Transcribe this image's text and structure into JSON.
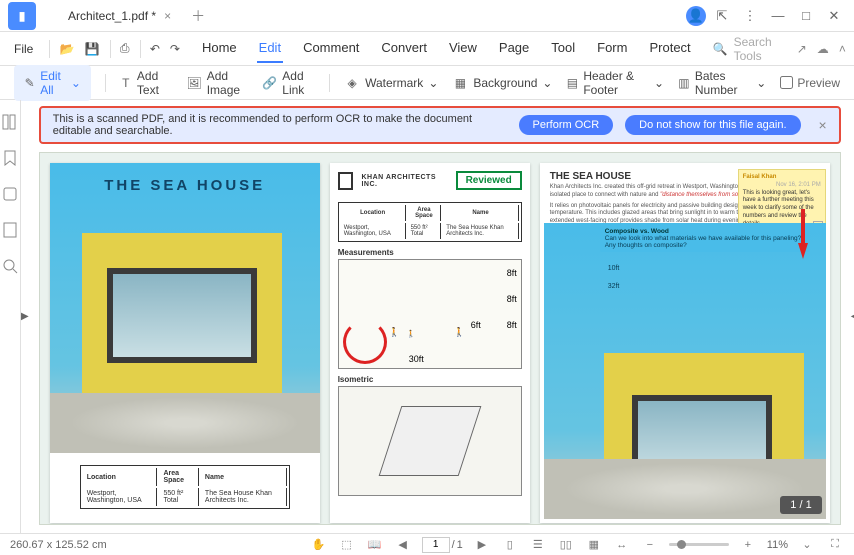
{
  "title": {
    "tab_name": "Architect_1.pdf *"
  },
  "menubar": {
    "file": "File",
    "items": [
      "Home",
      "Edit",
      "Comment",
      "Convert",
      "View",
      "Page",
      "Tool",
      "Form",
      "Protect"
    ],
    "active_index": 1,
    "search_placeholder": "Search Tools"
  },
  "toolbar": {
    "edit_all": "Edit All",
    "add_text": "Add Text",
    "add_image": "Add Image",
    "add_link": "Add Link",
    "watermark": "Watermark",
    "background": "Background",
    "header_footer": "Header & Footer",
    "bates_number": "Bates Number",
    "preview": "Preview"
  },
  "ocr_banner": {
    "message": "This is a scanned PDF, and it is recommended to perform OCR to make the document editable and searchable.",
    "btn_primary": "Perform OCR",
    "btn_secondary": "Do not show for this file again."
  },
  "page1": {
    "title": "THE SEA HOUSE",
    "cols": [
      "Location",
      "Area Space",
      "Name"
    ],
    "row": [
      "Westport, Washington, USA",
      "550 ft² Total",
      "The Sea House Khan Architects Inc."
    ]
  },
  "page2": {
    "company": "KHAN  ARCHITECTS INC.",
    "stamp": "Reviewed",
    "cols": [
      "Location",
      "Area Space",
      "Name"
    ],
    "row": [
      "Westport, Washington, USA",
      "550 ft² Total",
      "The Sea House Khan Architects Inc."
    ],
    "section1": "Measurements",
    "section2": "Isometric",
    "dims": [
      "8ft",
      "8ft",
      "8ft",
      "6ft",
      "30ft"
    ]
  },
  "page3": {
    "title": "THE SEA HOUSE",
    "para1": "Khan Architects Inc. created this off-grid retreat in Westport, Washington for a family looking for an isolated place to connect with nature and ",
    "highlight": "\"distance themselves from social pressure.\"",
    "para2": "It relies on photovoltaic panels for electricity and passive building designs to regulate its internal temperature. This includes glazed areas that bring sunlight in to warm the interior in winter, while an extended west-facing roof provides shade from solar heat during evenings in the summer.",
    "sticky": {
      "author": "Faisal Khan",
      "date": "Nov 16, 2:01 PM",
      "text": "This is looking great, let's have a further meeting this week to clarify some of the numbers and review the details."
    },
    "note": {
      "bold": "Composite vs. Wood",
      "text": "Can we look into what materials we have available for this paneling? Any thoughts on composite?"
    },
    "dims": [
      "10ft",
      "32ft"
    ]
  },
  "page_indicator": "1 / 1",
  "statusbar": {
    "coords": "260.67 x 125.52 cm",
    "page_current": "1",
    "page_total": "1",
    "zoom": "11%"
  }
}
